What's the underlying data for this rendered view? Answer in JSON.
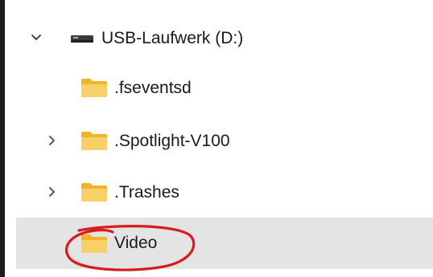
{
  "tree": {
    "drive": {
      "label": "USB-Laufwerk (D:)",
      "expanded": true,
      "icon": "usb-drive-icon"
    },
    "items": [
      {
        "label": ".fseventsd",
        "has_children": false,
        "selected": false,
        "icon": "folder-icon"
      },
      {
        "label": ".Spotlight-V100",
        "has_children": true,
        "selected": false,
        "icon": "folder-icon"
      },
      {
        "label": ".Trashes",
        "has_children": true,
        "selected": false,
        "icon": "folder-icon"
      },
      {
        "label": "Video",
        "has_children": false,
        "selected": true,
        "icon": "folder-icon"
      }
    ]
  },
  "colors": {
    "selection_bg": "#e4e4e4",
    "annotation": "#d81b1b",
    "folder": "#f5c242"
  }
}
